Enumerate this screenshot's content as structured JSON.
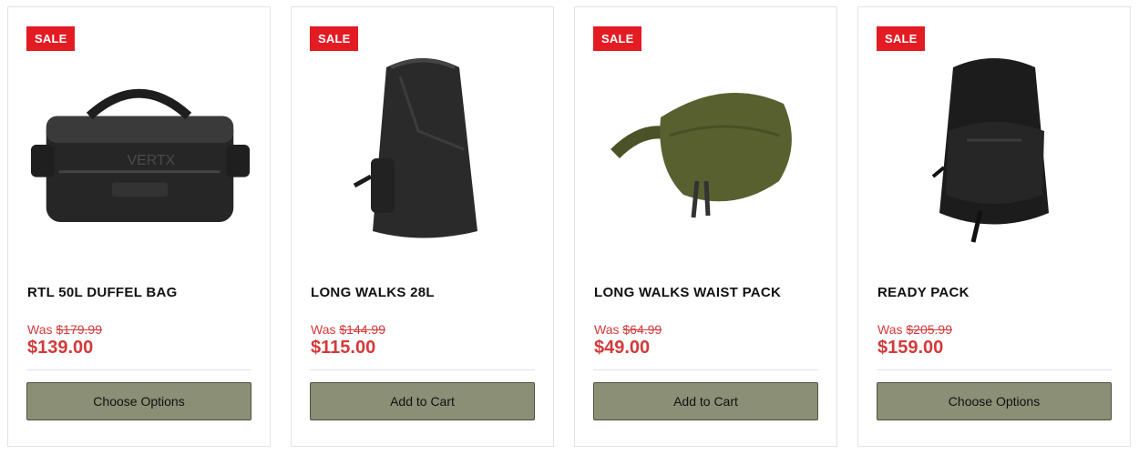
{
  "products": [
    {
      "badge": "SALE",
      "title": "RTL 50L DUFFEL BAG",
      "was_label": "Was",
      "was_price": "$179.99",
      "price": "$139.00",
      "button": "Choose Options",
      "image_icon": "duffel-bag-icon",
      "image_color": "#2b2b2b"
    },
    {
      "badge": "SALE",
      "title": "LONG WALKS 28L",
      "was_label": "Was",
      "was_price": "$144.99",
      "price": "$115.00",
      "button": "Add to Cart",
      "image_icon": "backpack-icon",
      "image_color": "#2b2b2b"
    },
    {
      "badge": "SALE",
      "title": "LONG WALKS WAIST PACK",
      "was_label": "Was",
      "was_price": "$64.99",
      "price": "$49.00",
      "button": "Add to Cart",
      "image_icon": "waist-pack-icon",
      "image_color": "#596030"
    },
    {
      "badge": "SALE",
      "title": "READY PACK",
      "was_label": "Was",
      "was_price": "$205.99",
      "price": "$159.00",
      "button": "Choose Options",
      "image_icon": "backpack-icon",
      "image_color": "#1c1c1c"
    }
  ],
  "colors": {
    "sale_badge": "#e31b23",
    "price": "#d33a3a",
    "button_bg": "#8a8f75"
  }
}
